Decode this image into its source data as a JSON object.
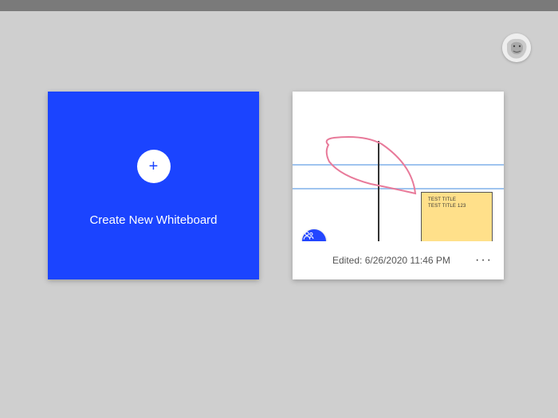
{
  "create_card": {
    "label": "Create New Whiteboard",
    "plus_glyph": "+"
  },
  "board": {
    "edited_prefix": "Edited:",
    "edited_timestamp": "6/26/2020 11:46 PM",
    "menu_glyph": "···",
    "share_icon": "invite-icon",
    "sticky": {
      "line1": "TEST TITLE",
      "line2": "TEST TITLE 123"
    }
  },
  "colors": {
    "accent": "#1b44ff",
    "sticky": "#ffe08a",
    "bg": "#cfcfcf"
  }
}
